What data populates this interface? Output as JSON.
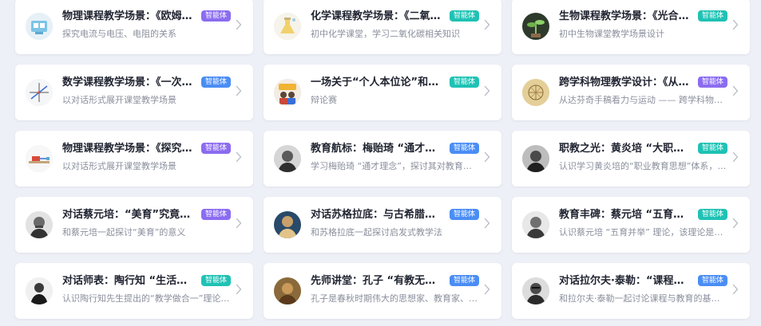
{
  "badge_label": "智能体",
  "badge_colors": {
    "blue": "#4a8df5",
    "purple": "#8b6cf0",
    "teal": "#1fc2b4"
  },
  "cards": [
    {
      "title": "物理课程教学场景：《欧姆定…",
      "desc": "探究电流与电压、电阻的关系",
      "badge_color": "purple",
      "icon": "physics-lab-image"
    },
    {
      "title": "化学课程教学场景：《二氧化…",
      "desc": "初中化学课堂，学习二氧化碳相关知识",
      "badge_color": "teal",
      "icon": "chemistry-flask-image"
    },
    {
      "title": "生物课程教学场景：《光合作…",
      "desc": "初中生物课堂教学场景设计",
      "badge_color": "teal",
      "icon": "plant-image"
    },
    {
      "title": "数学课程教学场景：《一次函…",
      "desc": "以对话形式展开课堂教学场景",
      "badge_color": "blue",
      "icon": "function-graph-image"
    },
    {
      "title": "一场关于“个人本位论”和“…",
      "desc": "辩论赛",
      "badge_color": "teal",
      "icon": "debate-image"
    },
    {
      "title": "跨学科物理教学设计：《从达…",
      "desc": "从达芬奇手稿看力与运动 —— 跨学科物理探…",
      "badge_color": "purple",
      "icon": "da-vinci-manuscript-image"
    },
    {
      "title": "物理课程教学场景：《探究摩…",
      "desc": "以对话形式展开课堂教学场景",
      "badge_color": "purple",
      "icon": "friction-experiment-image"
    },
    {
      "title": "教育航标：梅贻琦 “通才理念…",
      "desc": "学习梅贻琦 “通才理念”，探讨其对教育发…",
      "badge_color": "blue",
      "icon": "portrait-mei-yiqi"
    },
    {
      "title": "职教之光：黄炎培 “大职业教…",
      "desc": "认识学习黄炎培的“职业教育思想”体系，…",
      "badge_color": "teal",
      "icon": "portrait-huang-yanpei"
    },
    {
      "title": "对话蔡元培：“美育”究竟是…",
      "desc": "和蔡元培一起探讨“美育”的意义",
      "badge_color": "purple",
      "icon": "portrait-cai-yuanpei"
    },
    {
      "title": "对话苏格拉底：与古希腊哲学…",
      "desc": "和苏格拉底一起探讨启发式教学法",
      "badge_color": "blue",
      "icon": "portrait-socrates"
    },
    {
      "title": "教育丰碑：蔡元培 “五育并举…",
      "desc": "认识蔡元培 “五育并举” 理论，该理论是中…",
      "badge_color": "teal",
      "icon": "portrait-cai-yuanpei-2"
    },
    {
      "title": "对话师表：陶行知 “生活教育…",
      "desc": "认识陶行知先生提出的“教学做合一”理论，…",
      "badge_color": "teal",
      "icon": "portrait-tao-xingzhi"
    },
    {
      "title": "先师讲堂：孔子 “有教无类”…",
      "desc": "孔子是春秋时期伟大的思想家、教育家、政…",
      "badge_color": "blue",
      "icon": "portrait-confucius"
    },
    {
      "title": "对话拉尔夫·泰勒：“课程理论…",
      "desc": "和拉尔夫·泰勒一起讨论课程与教育的基本原理",
      "badge_color": "blue",
      "icon": "portrait-ralph-tyler"
    }
  ]
}
